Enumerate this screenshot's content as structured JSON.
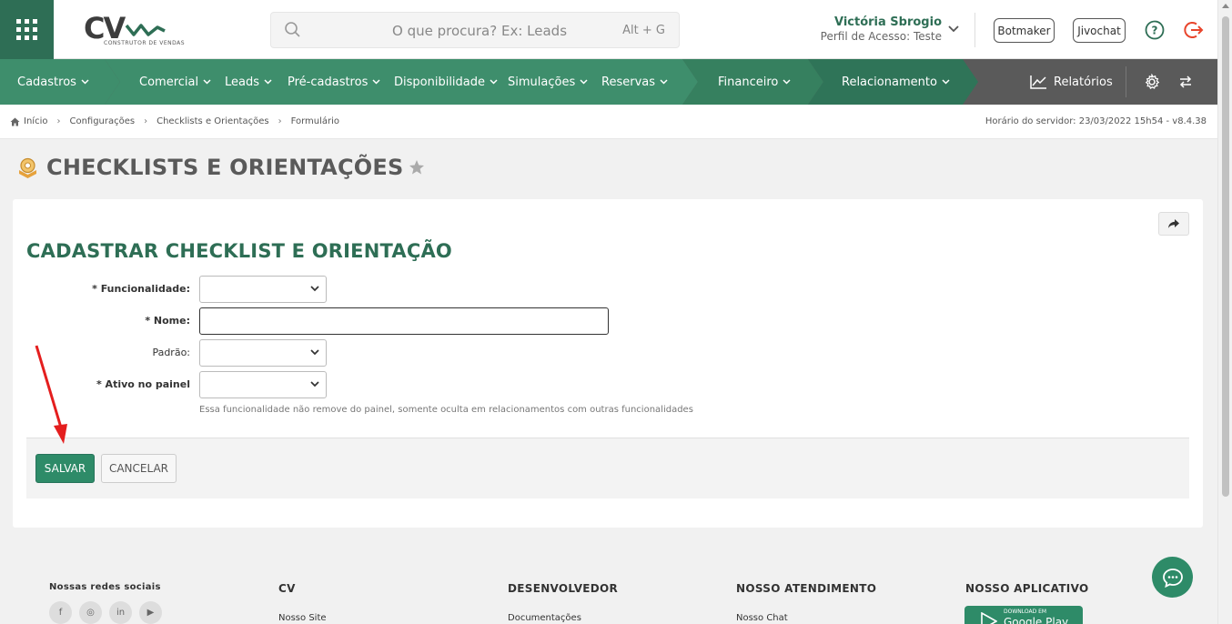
{
  "header": {
    "logo_text": "CV",
    "logo_tagline": "CONSTRUTOR DE VENDAS",
    "search_placeholder": "O que procura? Ex: Leads",
    "search_shortcut": "Alt + G",
    "user_name": "Victória Sbrogio",
    "user_profile": "Perfil de Acesso: Teste",
    "botmaker_label": "Botmaker",
    "jivochat_label": "Jivochat"
  },
  "nav": {
    "items": [
      {
        "label": "Cadastros"
      },
      {
        "label": "Comercial"
      },
      {
        "label": "Leads"
      },
      {
        "label": "Pré-cadastros"
      },
      {
        "label": "Disponibilidade"
      },
      {
        "label": "Simulações"
      },
      {
        "label": "Reservas"
      },
      {
        "label": "Financeiro"
      },
      {
        "label": "Relacionamento"
      }
    ],
    "reports_label": "Relatórios"
  },
  "breadcrumb": {
    "items": [
      "Início",
      "Configurações",
      "Checklists e Orientações",
      "Formulário"
    ],
    "server_time": "Horário do servidor: 23/03/2022 15h54 - v8.4.38"
  },
  "page": {
    "title": "CHECKLISTS E ORIENTAÇÕES"
  },
  "form": {
    "title": "CADASTRAR CHECKLIST E ORIENTAÇÃO",
    "fields": {
      "funcionalidade_label": "* Funcionalidade:",
      "funcionalidade_value": "",
      "nome_label": "* Nome:",
      "nome_value": "",
      "padrao_label": "Padrão:",
      "padrao_value": "",
      "ativo_label": "* Ativo no painel",
      "ativo_value": "",
      "ativo_hint": "Essa funcionalidade não remove do painel, somente oculta em relacionamentos com outras funcionalidades"
    },
    "save_label": "SALVAR",
    "cancel_label": "CANCELAR"
  },
  "footer": {
    "social_title": "Nossas redes sociais",
    "social_icons": [
      "f",
      "◎",
      "in",
      "▶"
    ],
    "cv_title": "CV",
    "cv_link": "Nosso Site",
    "dev_title": "DESENVOLVEDOR",
    "dev_link": "Documentações",
    "support_title": "NOSSO ATENDIMENTO",
    "support_link": "Nosso Chat",
    "app_title": "NOSSO APLICATIVO",
    "gplay_small": "DOWNLOAD EM",
    "gplay_big": "Google Play"
  },
  "colors": {
    "brand_green": "#2e6e55",
    "nav_green": "#3e8e6c",
    "nav_dark_green": "#2f7458",
    "nav_gray": "#5a5a5a",
    "save_green": "#2e8b68",
    "annotation_red": "#e41e1e"
  }
}
